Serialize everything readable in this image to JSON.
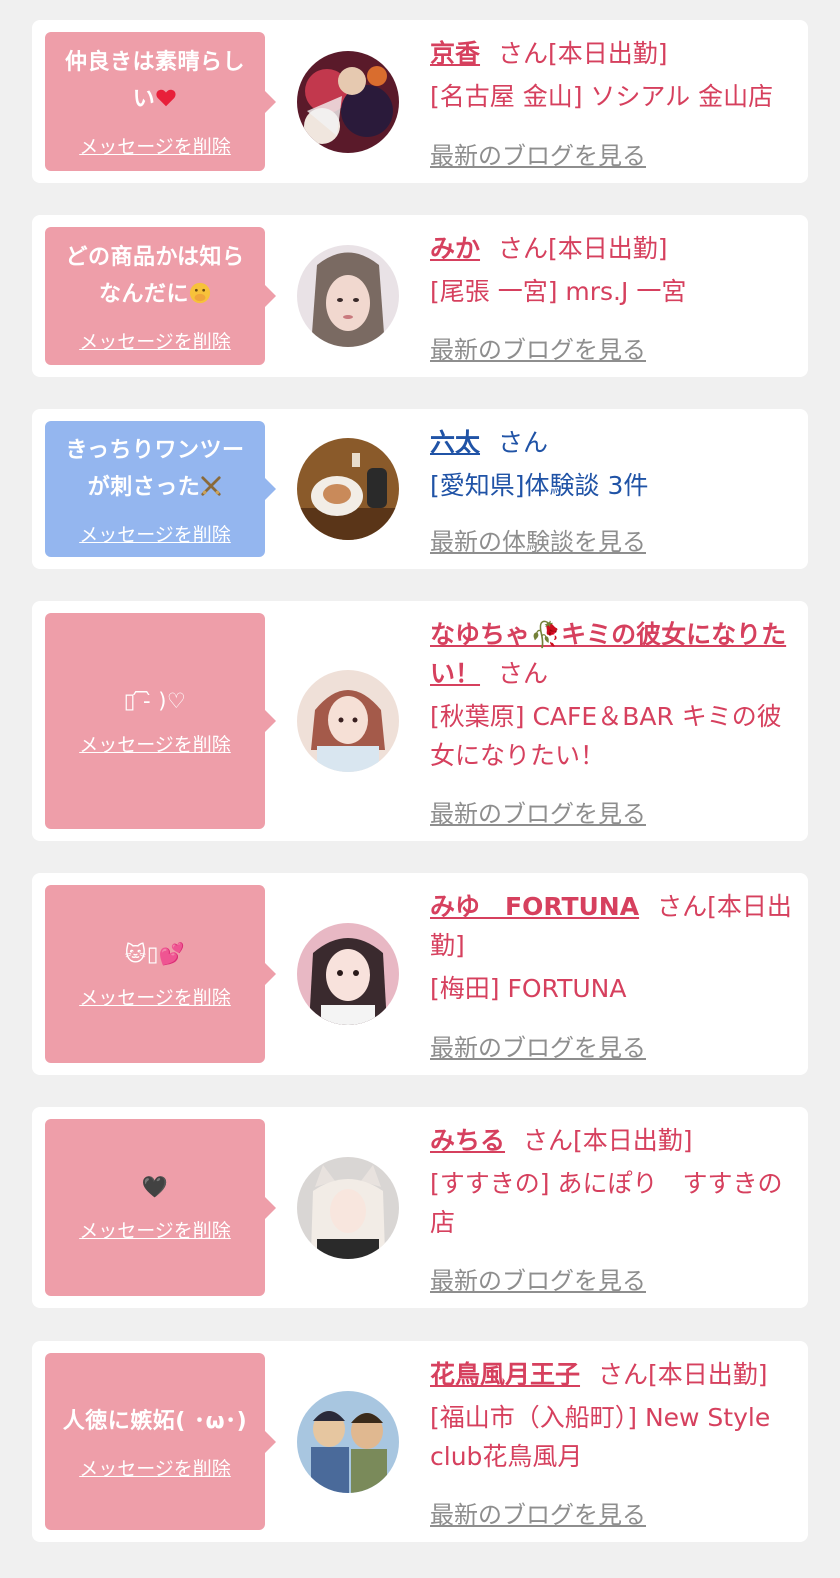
{
  "cards": [
    {
      "message": "仲良きは素晴らしい",
      "message_emoji": "heart-red",
      "delete_label": "メッセージを削除",
      "name": "京香",
      "suffix": "さん[本日出勤]",
      "shop": "[名古屋 金山] ソシアル 金山店",
      "more": "最新のブログを見る",
      "color": "pink"
    },
    {
      "message": "どの商品かは知らなんだに",
      "message_emoji": "hand-over-mouth-face",
      "delete_label": "メッセージを削除",
      "name": "みか",
      "suffix": "さん[本日出勤]",
      "shop": "[尾張 一宮] mrs.J 一宮",
      "more": "最新のブログを見る",
      "color": "pink"
    },
    {
      "message": "きっちりワンツーが刺さった",
      "message_emoji": "crossed-swords",
      "delete_label": "メッセージを削除",
      "name": "六太",
      "suffix": "さん",
      "shop": "[愛知県]体験談 3件",
      "more": "最新の体験談を見る",
      "color": "blue"
    },
    {
      "message": "▯ ᷇-᷆ )♡",
      "message_emoji": "",
      "delete_label": "メッセージを削除",
      "name": "なゆちゃ🥀キミの彼女になりたい！",
      "suffix": "さん",
      "shop": "[秋葉原] CAFE＆BAR キミの彼女になりたい！",
      "more": "最新のブログを見る",
      "color": "pink"
    },
    {
      "message": "🐱▯💕",
      "message_emoji": "",
      "delete_label": "メッセージを削除",
      "name": "みゆ　FORTUNA",
      "suffix": "さん[本日出勤]",
      "shop": "[梅田] FORTUNA",
      "more": "最新のブログを見る",
      "color": "pink"
    },
    {
      "message": "🖤",
      "message_emoji": "",
      "delete_label": "メッセージを削除",
      "name": "みちる",
      "suffix": "さん[本日出勤]",
      "shop": "[すすきの] あにぽり　すすきの店",
      "more": "最新のブログを見る",
      "color": "pink"
    },
    {
      "message": "人徳に嫉妬( ･ω･)",
      "message_emoji": "",
      "delete_label": "メッセージを削除",
      "name": "花鳥風月王子",
      "suffix": "さん[本日出勤]",
      "shop": "[福山市（入船町）] New Style club花鳥風月",
      "more": "最新のブログを見る",
      "color": "pink"
    }
  ],
  "colors": {
    "bubble_pink": "#ee9ea9",
    "bubble_blue": "#94b6ef",
    "text_pink": "#d6405e",
    "text_blue": "#2053a6",
    "link_gray": "#8e8e8e"
  }
}
